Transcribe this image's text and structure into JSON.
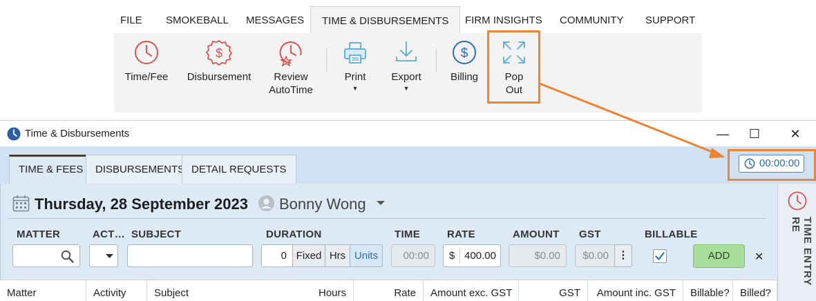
{
  "ribbon": {
    "tabs": [
      "FILE",
      "SMOKEBALL",
      "MESSAGES",
      "TIME & DISBURSEMENTS",
      "FIRM INSIGHTS",
      "COMMUNITY",
      "SUPPORT"
    ],
    "buttons": {
      "time_fee": "Time/Fee",
      "disbursement": "Disbursement",
      "review_1": "Review",
      "review_2": "AutoTime",
      "print": "Print",
      "export": "Export",
      "billing": "Billing",
      "popout_1": "Pop",
      "popout_2": "Out"
    },
    "icon_names": [
      "clock-icon",
      "dollar-seal-icon",
      "clock-star-icon",
      "printer-icon",
      "download-icon",
      "dollar-circle-icon",
      "expand-arrows-icon"
    ]
  },
  "window": {
    "title": "Time & Disbursements",
    "controls": {
      "minimize": "—",
      "maximize": "☐",
      "close": "✕"
    },
    "tabs": [
      "TIME & FEES",
      "DISBURSEMENTS",
      "DETAIL REQUESTS"
    ],
    "timer": "00:00:00",
    "side_panel_label": "TIME ENTRY RE"
  },
  "entry": {
    "date": "Thursday, 28 September 2023",
    "user": "Bonny Wong",
    "labels": {
      "matter": "MATTER",
      "activity": "ACT…",
      "subject": "SUBJECT",
      "duration": "DURATION",
      "time": "TIME",
      "rate": "RATE",
      "amount": "AMOUNT",
      "gst": "GST",
      "billable": "BILLABLE"
    },
    "duration_value": "0",
    "duration_modes": [
      "Fixed",
      "Hrs",
      "Units"
    ],
    "active_mode": "Units",
    "time_value": "00:00",
    "rate_currency": "$",
    "rate_value": "400.00",
    "amount_value": "$0.00",
    "gst_value": "$0.00",
    "billable_checked": true,
    "add_label": "ADD",
    "clear_label": "✕"
  },
  "grid": {
    "columns": [
      "Matter",
      "Activity",
      "Subject",
      "Hours",
      "Rate",
      "Amount exc. GST",
      "GST",
      "Amount inc. GST",
      "Billable?",
      "Billed?"
    ]
  },
  "colors": {
    "accent_blue": "#2b6cb3",
    "highlight_orange": "#ee8332",
    "ribbon_red": "#d9534f",
    "ribbon_blue": "#5aaad8",
    "add_green": "#a8dd9c"
  }
}
